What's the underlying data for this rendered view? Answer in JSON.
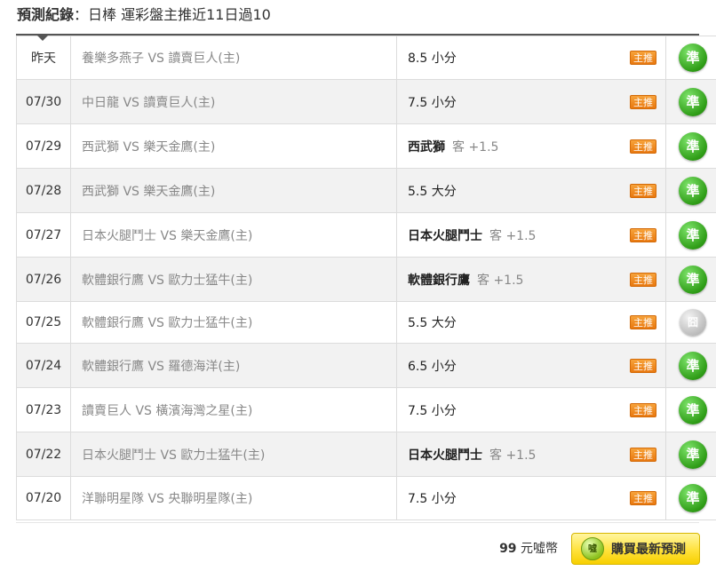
{
  "header": {
    "title_label": "預測紀錄",
    "title_rest": "：日棒 運彩盤主推近11日過10"
  },
  "records": [
    {
      "date": "昨天",
      "match": "養樂多燕子 VS 讀賣巨人(主)",
      "pick_team": "",
      "pick_text": "8.5 小分",
      "pick_side": "",
      "badge": "主推",
      "result": "準",
      "result_type": "win"
    },
    {
      "date": "07/30",
      "match": "中日龍 VS 讀賣巨人(主)",
      "pick_team": "",
      "pick_text": "7.5 小分",
      "pick_side": "",
      "badge": "主推",
      "result": "準",
      "result_type": "win"
    },
    {
      "date": "07/29",
      "match": "西武獅 VS 樂天金鷹(主)",
      "pick_team": "西武獅",
      "pick_text": "",
      "pick_side": "客 +1.5",
      "badge": "主推",
      "result": "準",
      "result_type": "win"
    },
    {
      "date": "07/28",
      "match": "西武獅 VS 樂天金鷹(主)",
      "pick_team": "",
      "pick_text": "5.5 大分",
      "pick_side": "",
      "badge": "主推",
      "result": "準",
      "result_type": "win"
    },
    {
      "date": "07/27",
      "match": "日本火腿鬥士 VS 樂天金鷹(主)",
      "pick_team": "日本火腿鬥士",
      "pick_text": "",
      "pick_side": "客 +1.5",
      "badge": "主推",
      "result": "準",
      "result_type": "win"
    },
    {
      "date": "07/26",
      "match": "軟體銀行鷹 VS 歐力士猛牛(主)",
      "pick_team": "軟體銀行鷹",
      "pick_text": "",
      "pick_side": "客 +1.5",
      "badge": "主推",
      "result": "準",
      "result_type": "win"
    },
    {
      "date": "07/25",
      "match": "軟體銀行鷹 VS 歐力士猛牛(主)",
      "pick_team": "",
      "pick_text": "5.5 大分",
      "pick_side": "",
      "badge": "主推",
      "result": "囧",
      "result_type": "lose"
    },
    {
      "date": "07/24",
      "match": "軟體銀行鷹 VS 羅德海洋(主)",
      "pick_team": "",
      "pick_text": "6.5 小分",
      "pick_side": "",
      "badge": "主推",
      "result": "準",
      "result_type": "win"
    },
    {
      "date": "07/23",
      "match": "讀賣巨人 VS 橫濱海灣之星(主)",
      "pick_team": "",
      "pick_text": "7.5 小分",
      "pick_side": "",
      "badge": "主推",
      "result": "準",
      "result_type": "win"
    },
    {
      "date": "07/22",
      "match": "日本火腿鬥士 VS 歐力士猛牛(主)",
      "pick_team": "日本火腿鬥士",
      "pick_text": "",
      "pick_side": "客 +1.5",
      "badge": "主推",
      "result": "準",
      "result_type": "win"
    },
    {
      "date": "07/20",
      "match": "洋聯明星隊 VS 央聯明星隊(主)",
      "pick_team": "",
      "pick_text": "7.5 小分",
      "pick_side": "",
      "badge": "主推",
      "result": "準",
      "result_type": "win"
    }
  ],
  "footer": {
    "price_value": "99",
    "price_unit": "元噓幣",
    "coin_icon_text": "噓",
    "buy_label": "購買最新預測"
  },
  "colors": {
    "win": "#2f9d17",
    "lose": "#bdbdbd",
    "badge": "#f08c1e",
    "buy_button": "#ffe23c"
  }
}
